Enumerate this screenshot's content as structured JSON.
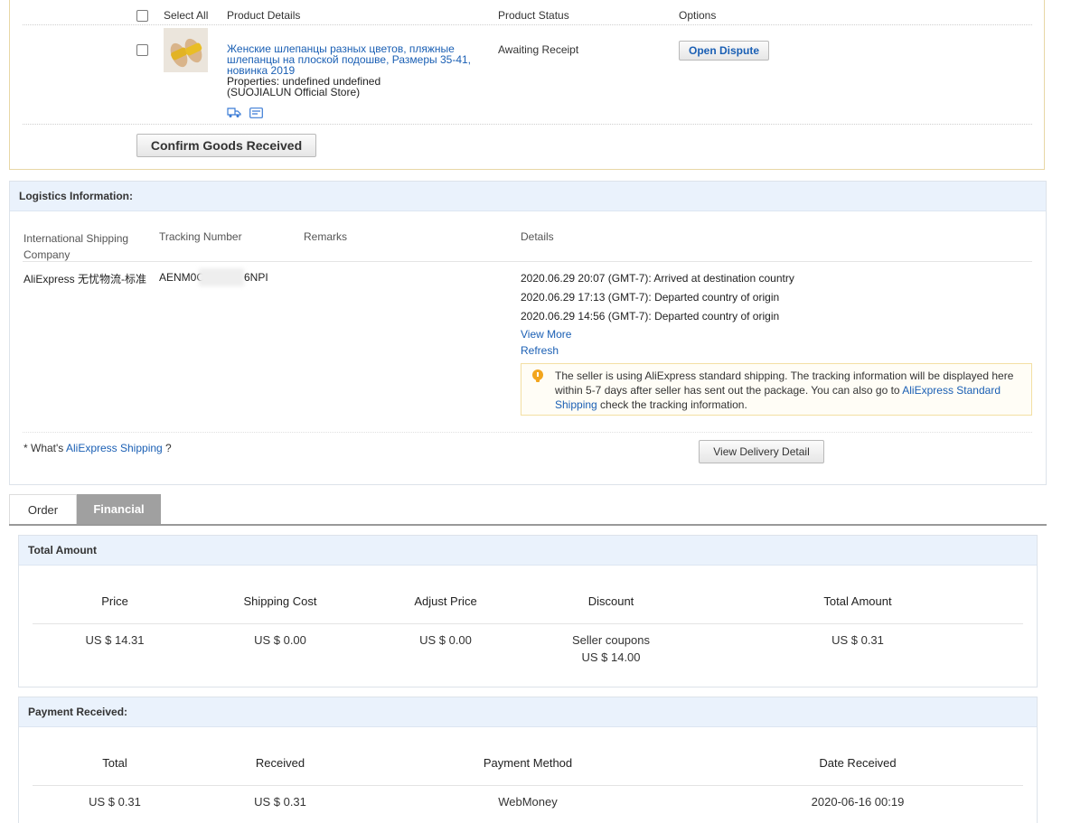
{
  "order_items": {
    "headers": {
      "select_all": "Select All",
      "product_details": "Product Details",
      "product_status": "Product Status",
      "options": "Options"
    },
    "item": {
      "title": "Женские шлепанцы разных цветов, пляжные шлепанцы на плоской подошве, Размеры 35-41, новинка 2019",
      "properties": "Properties: undefined undefined",
      "store": "(SUOJIALUN Official Store)",
      "status": "Awaiting Receipt",
      "option_button": "Open Dispute"
    },
    "confirm_button": "Confirm Goods Received"
  },
  "logistics": {
    "title": "Logistics Information:",
    "headers": {
      "company": "International Shipping Company",
      "tracking": "Tracking Number",
      "remarks": "Remarks",
      "details": "Details"
    },
    "row": {
      "company": "AliExpress 无忧物流-标准",
      "tracking_prefix": "AENM0C",
      "tracking_suffix": "6NPI",
      "events": [
        "2020.06.29 20:07 (GMT-7): Arrived at destination country",
        "2020.06.29 17:13 (GMT-7): Departed country of origin",
        "2020.06.29 14:56 (GMT-7): Departed country of origin"
      ],
      "view_more": "View More",
      "refresh": "Refresh"
    },
    "tip": {
      "text_before": "The seller is using AliExpress standard shipping. The tracking information will be displayed here within 5-7 days after seller has sent out the package. You can also go to ",
      "link": "AliExpress Standard Shipping",
      "text_after": " check the tracking information."
    },
    "footer": {
      "prefix": "* What's ",
      "link": "AliExpress Shipping",
      "suffix": " ?",
      "button": "View Delivery Detail"
    }
  },
  "tabs": [
    {
      "label": "Order",
      "active": false
    },
    {
      "label": "Financial",
      "active": true
    }
  ],
  "total_amount": {
    "title": "Total Amount",
    "headers": [
      "Price",
      "Shipping Cost",
      "Adjust Price",
      "Discount",
      "Total Amount"
    ],
    "values": {
      "price": "US $ 14.31",
      "shipping": "US $ 0.00",
      "adjust": "US $ 0.00",
      "discount_label": "Seller coupons",
      "discount_value": "US $ 14.00",
      "total": "US $ 0.31"
    }
  },
  "payment": {
    "title": "Payment Received:",
    "headers": [
      "Total",
      "Received",
      "Payment Method",
      "Date Received"
    ],
    "values": {
      "total": "US $ 0.31",
      "received": "US $ 0.31",
      "method": "WebMoney",
      "date": "2020-06-16 00:19"
    }
  },
  "colors": {
    "link": "#1a5fb4",
    "section_header_bg": "#eaf2fc",
    "tip_icon": "#f2a51d",
    "tab_active_bg": "#a0a0a0"
  }
}
